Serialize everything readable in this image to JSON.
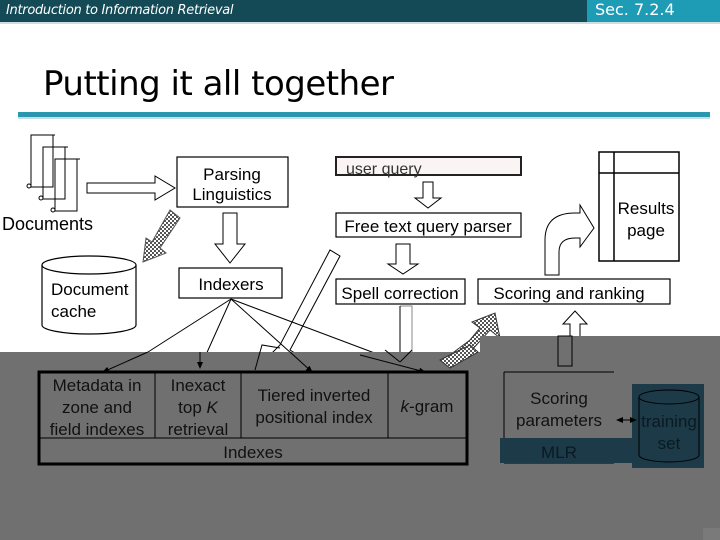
{
  "header": {
    "course_title": "Introduction to Information Retrieval",
    "section": "Sec. 7.2.4"
  },
  "slide": {
    "title": "Putting it all together"
  },
  "diagram": {
    "documents_label": "Documents",
    "parsing_line1": "Parsing",
    "parsing_line2": "Linguistics",
    "document_cache_line1": "Document",
    "document_cache_line2": "cache",
    "indexers_label": "Indexers",
    "user_query_label": "user query",
    "free_text_parser_label": "Free text query parser",
    "spell_correction_label": "Spell correction",
    "scoring_ranking_label": "Scoring and ranking",
    "results_line1": "Results",
    "results_line2": "page",
    "indexes": {
      "metadata_line1": "Metadata in",
      "metadata_line2": "zone and",
      "metadata_line3": "field indexes",
      "inexact_line1": "Inexact",
      "inexact_line2_prefix": "top ",
      "inexact_line2_k": "K",
      "inexact_line3": "retrieval",
      "tiered_line1": "Tiered inverted",
      "tiered_line2": "positional index",
      "kgram_k": "k",
      "kgram_rest": "-gram",
      "footer": "Indexes"
    },
    "scoring_params_line1": "Scoring",
    "scoring_params_line2": "parameters",
    "mlr_label": "MLR",
    "training_line1": "training",
    "training_line2": "set"
  },
  "colors": {
    "header_dark": "#134a55",
    "header_accent": "#1e9bb5",
    "rule": "#2a97ae",
    "overlay_gray": "#707070",
    "dark_navy": "#1d3a48"
  }
}
